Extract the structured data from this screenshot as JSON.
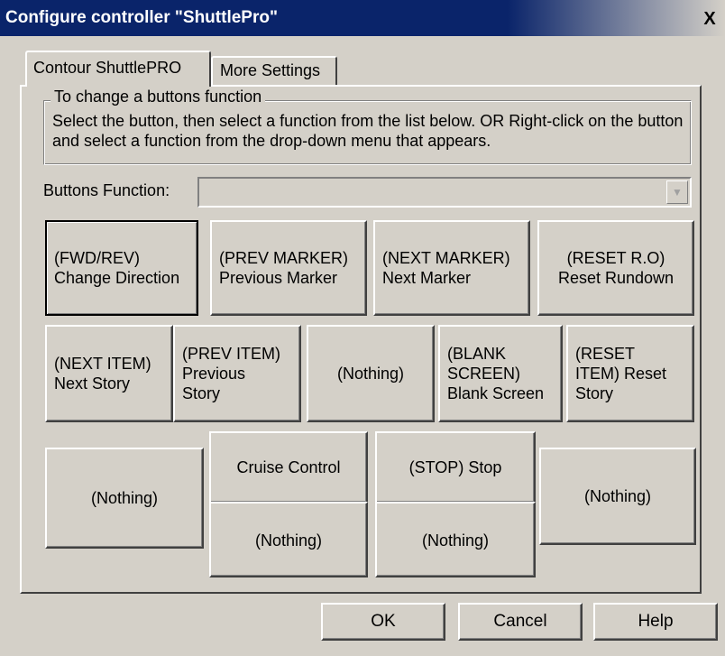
{
  "window": {
    "title": "Configure controller \"ShuttlePro\"",
    "close_glyph": "X"
  },
  "tabs": [
    {
      "label": "Contour ShuttlePRO",
      "active": true
    },
    {
      "label": "More Settings",
      "active": false
    }
  ],
  "group": {
    "legend": "To change a buttons function",
    "description": "Select the button, then select a function from the list below. OR Right-click on the button and select a function from the drop-down menu that appears."
  },
  "buttons_function": {
    "label": "Buttons Function:",
    "value": ""
  },
  "shuttle_buttons": {
    "row1": [
      {
        "lines": [
          "(FWD/REV)",
          "Change Direction"
        ]
      },
      {
        "lines": [
          "(PREV MARKER)",
          "Previous Marker"
        ]
      },
      {
        "lines": [
          "(NEXT MARKER)",
          "Next Marker"
        ]
      },
      {
        "lines": [
          "(RESET R.O)",
          "Reset Rundown"
        ]
      }
    ],
    "row2": [
      {
        "lines": [
          "(NEXT ITEM)",
          "Next Story"
        ]
      },
      {
        "lines": [
          "(PREV ITEM)",
          "Previous",
          "Story"
        ]
      },
      {
        "lines": [
          "(Nothing)"
        ]
      },
      {
        "lines": [
          "(BLANK",
          "SCREEN)",
          "Blank Screen"
        ]
      },
      {
        "lines": [
          "(RESET",
          "ITEM) Reset",
          "Story"
        ]
      }
    ],
    "bottom": {
      "left": "(Nothing)",
      "cruise": "Cruise Control",
      "cruise_below": "(Nothing)",
      "stop": "(STOP) Stop",
      "stop_below": "(Nothing)",
      "right": "(Nothing)"
    }
  },
  "dialog_buttons": {
    "ok": "OK",
    "cancel": "Cancel",
    "help": "Help"
  }
}
